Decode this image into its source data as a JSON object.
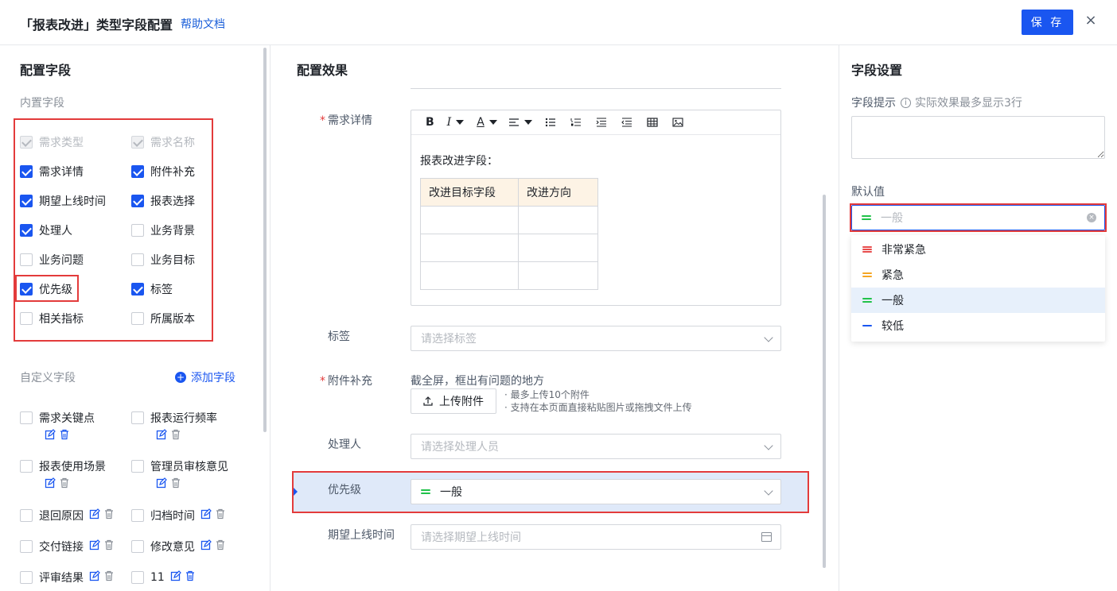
{
  "header": {
    "title": "「报表改进」类型字段配置",
    "help": "帮助文档",
    "save": "保 存",
    "close": "×"
  },
  "left": {
    "title": "配置字段",
    "builtin_title": "内置字段",
    "builtin_fields": [
      {
        "label": "需求类型",
        "checked": true,
        "disabled": true
      },
      {
        "label": "需求名称",
        "checked": true,
        "disabled": true
      },
      {
        "label": "需求详情",
        "checked": true,
        "disabled": false
      },
      {
        "label": "附件补充",
        "checked": true,
        "disabled": false
      },
      {
        "label": "期望上线时间",
        "checked": true,
        "disabled": false
      },
      {
        "label": "报表选择",
        "checked": true,
        "disabled": false
      },
      {
        "label": "处理人",
        "checked": true,
        "disabled": false
      },
      {
        "label": "业务背景",
        "checked": false,
        "disabled": false
      },
      {
        "label": "业务问题",
        "checked": false,
        "disabled": false
      },
      {
        "label": "业务目标",
        "checked": false,
        "disabled": false
      },
      {
        "label": "优先级",
        "checked": true,
        "disabled": false
      },
      {
        "label": "标签",
        "checked": true,
        "disabled": false
      },
      {
        "label": "相关指标",
        "checked": false,
        "disabled": false
      },
      {
        "label": "所属版本",
        "checked": false,
        "disabled": false
      }
    ],
    "custom_title": "自定义字段",
    "add_field": "添加字段",
    "custom_fields": [
      {
        "label": "需求关键点"
      },
      {
        "label": "报表运行频率"
      },
      {
        "label": "报表使用场景"
      },
      {
        "label": "管理员审核意见"
      },
      {
        "label": "退回原因"
      },
      {
        "label": "归档时间"
      },
      {
        "label": "交付链接"
      },
      {
        "label": "修改意见"
      },
      {
        "label": "评审结果"
      },
      {
        "label": "11"
      }
    ]
  },
  "middle": {
    "title": "配置效果",
    "req_detail_label": "需求详情",
    "toolbar": {
      "bold": "B",
      "italic": "I",
      "font_color": "A"
    },
    "editor_text": "报表改进字段：",
    "table_headers": [
      "改进目标字段",
      "改进方向"
    ],
    "tag_label": "标签",
    "tag_placeholder": "请选择标签",
    "attach_label": "附件补充",
    "attach_hint": "截全屏，框出有问题的地方",
    "upload_btn": "上传附件",
    "upload_note1": "· 最多上传10个附件",
    "upload_note2": "· 支持在本页面直接粘贴图片或拖拽文件上传",
    "handler_label": "处理人",
    "handler_placeholder": "请选择处理人员",
    "priority_label": "优先级",
    "priority_value": "一般",
    "date_label": "期望上线时间",
    "date_placeholder": "请选择期望上线时间"
  },
  "right": {
    "title": "字段设置",
    "tip_label": "字段提示",
    "tip_extra": "实际效果最多显示3行",
    "default_label": "默认值",
    "default_value": "一般",
    "options": [
      {
        "label": "非常紧急",
        "color": "#e84c4c",
        "bars": 3
      },
      {
        "label": "紧急",
        "color": "#f5a623",
        "bars": 2
      },
      {
        "label": "一般",
        "color": "#21c24a",
        "bars": 2,
        "selected": true
      },
      {
        "label": "较低",
        "color": "#1a56f0",
        "bars": 1
      }
    ]
  },
  "colors": {
    "primary": "#1a56f0",
    "highlight": "#e33b3b",
    "green": "#21c24a"
  }
}
